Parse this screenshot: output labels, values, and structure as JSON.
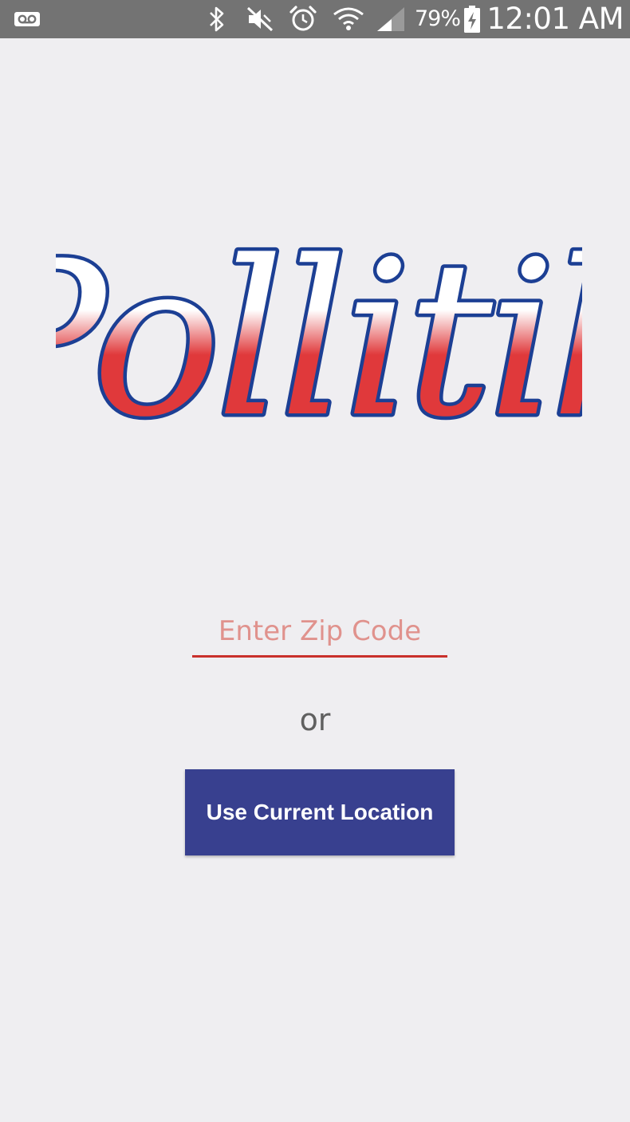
{
  "status_bar": {
    "battery_percent": "79%",
    "time": "12:01 AM",
    "icons": [
      "voicemail-icon",
      "bluetooth-icon",
      "mute-icon",
      "alarm-icon",
      "wifi-icon",
      "signal-icon",
      "battery-charging-icon"
    ]
  },
  "logo": {
    "text": "Pollitik",
    "colors": {
      "outline": "#1c3f94",
      "top": "#ffffff",
      "bottom": "#e0393b"
    }
  },
  "zip": {
    "placeholder": "Enter Zip Code",
    "value": ""
  },
  "separator": {
    "label": "or"
  },
  "location_button": {
    "label": "Use Current Location"
  },
  "colors": {
    "background": "#efeef1",
    "status_bar": "#737373",
    "accent_red": "#c9302c",
    "button_blue": "#38408f"
  }
}
